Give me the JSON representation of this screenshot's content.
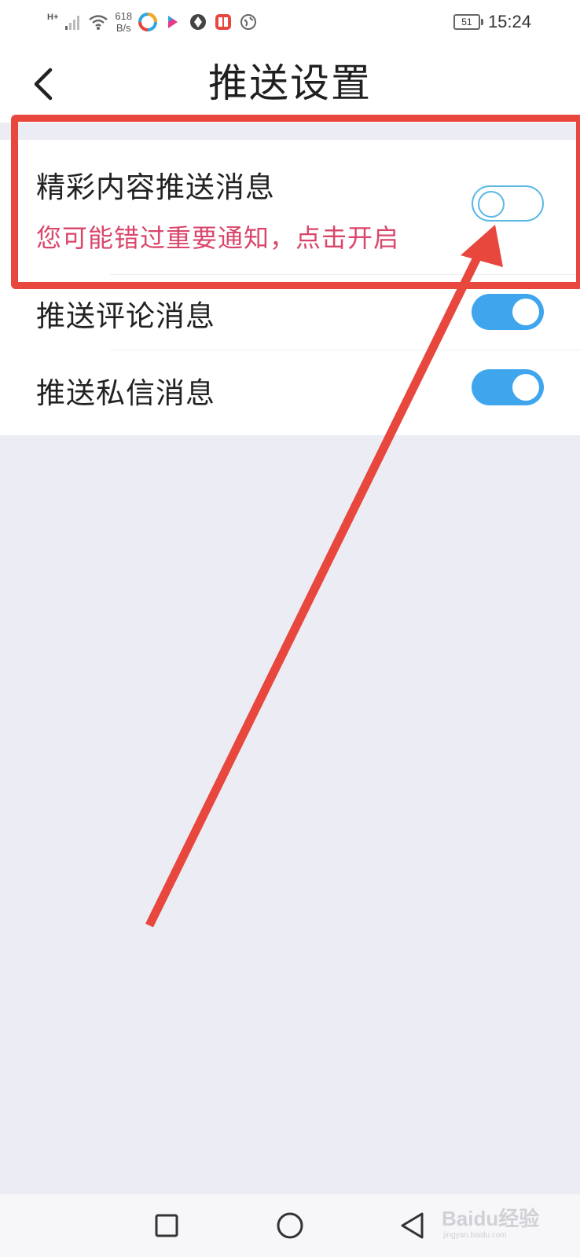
{
  "status_bar": {
    "network_type": "H+",
    "speed_value": "618",
    "speed_unit": "B/s",
    "battery": "51",
    "time": "15:24",
    "app_icons": [
      "color-ring-app-icon",
      "youku-icon",
      "aperture-app-icon",
      "reader-app-icon",
      "globe-app-icon"
    ]
  },
  "header": {
    "title": "推送设置",
    "back_icon": "chevron-left-icon"
  },
  "settings": {
    "items": [
      {
        "label": "精彩内容推送消息",
        "hint": "您可能错过重要通知，点击开启",
        "enabled": false
      },
      {
        "label": "推送评论消息",
        "enabled": true
      },
      {
        "label": "推送私信消息",
        "enabled": true
      }
    ]
  },
  "nav_bar": {
    "buttons": [
      "square-recent-icon",
      "circle-home-icon",
      "triangle-back-icon"
    ]
  },
  "watermark": {
    "text": "Baidu经验",
    "subtext": "jingyan.baidu.com"
  },
  "colors": {
    "accent": "#3FA6EE",
    "toggle_off_border": "#5AB8E5",
    "hint": "#D9466A",
    "annotation": "#E8473E",
    "page_background": "#ECEDF4"
  }
}
